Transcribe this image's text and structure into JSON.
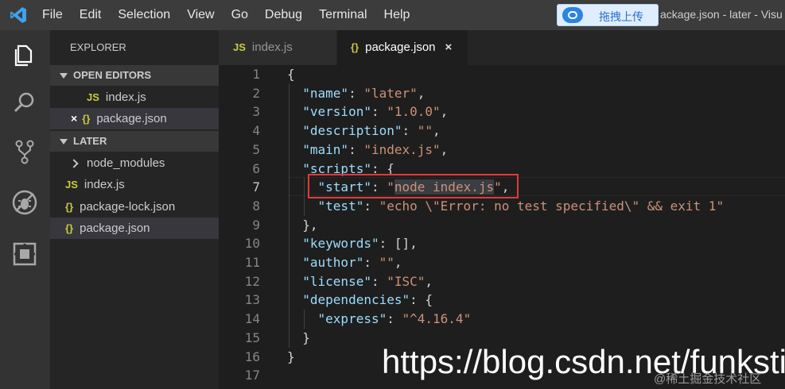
{
  "titlebar": {
    "menu": [
      "File",
      "Edit",
      "Selection",
      "View",
      "Go",
      "Debug",
      "Terminal",
      "Help"
    ],
    "upload_label": "拖拽上传",
    "window_title": "ackage.json - later - Visu"
  },
  "activity_icons": [
    "files-icon",
    "search-icon",
    "source-control-icon",
    "debug-icon",
    "extensions-icon"
  ],
  "sidebar": {
    "title": "EXPLORER",
    "open_editors_label": "OPEN EDITORS",
    "open_editors": [
      {
        "name": "index.js",
        "type": "JS"
      },
      {
        "name": "package.json",
        "type": "{}"
      }
    ],
    "project_label": "LATER",
    "files": [
      {
        "name": "node_modules",
        "type": "folder"
      },
      {
        "name": "index.js",
        "type": "JS"
      },
      {
        "name": "package-lock.json",
        "type": "{}"
      },
      {
        "name": "package.json",
        "type": "{}"
      }
    ],
    "close_glyph": "×"
  },
  "tabs": [
    {
      "label": "index.js",
      "icon": "JS",
      "active": false
    },
    {
      "label": "package.json",
      "icon": "{}",
      "active": true
    }
  ],
  "editor": {
    "line_numbers": [
      "1",
      "2",
      "3",
      "4",
      "5",
      "6",
      "7",
      "8",
      "9",
      "10",
      "11",
      "12",
      "13",
      "14",
      "15",
      "16",
      "17"
    ],
    "current_line": "7",
    "l1": "{",
    "l2k": "\"name\"",
    "l2v": "\"later\"",
    "l3k": "\"version\"",
    "l3v": "\"1.0.0\"",
    "l4k": "\"description\"",
    "l4v": "\"\"",
    "l5k": "\"main\"",
    "l5v": "\"index.js\"",
    "l6k": "\"scripts\"",
    "l6v": "{",
    "l7k": "\"start\"",
    "l7q": "\"",
    "l7v": "node index.js",
    "l7q2": "\"",
    "l8k": "\"test\"",
    "l8v": "\"echo \\\"Error: no test specified\\\" && exit 1\"",
    "l9": "},",
    "l10k": "\"keywords\"",
    "l10v": "[]",
    "l11k": "\"author\"",
    "l11v": "\"\"",
    "l12k": "\"license\"",
    "l12v": "\"ISC\"",
    "l13k": "\"dependencies\"",
    "l13v": "{",
    "l14k": "\"express\"",
    "l14v": "\"^4.16.4\"",
    "l15": "}",
    "l16": "}"
  },
  "watermark": {
    "url": "https://blog.csdn.net/funkstill",
    "secondary": "@稀土掘金技术社区"
  }
}
